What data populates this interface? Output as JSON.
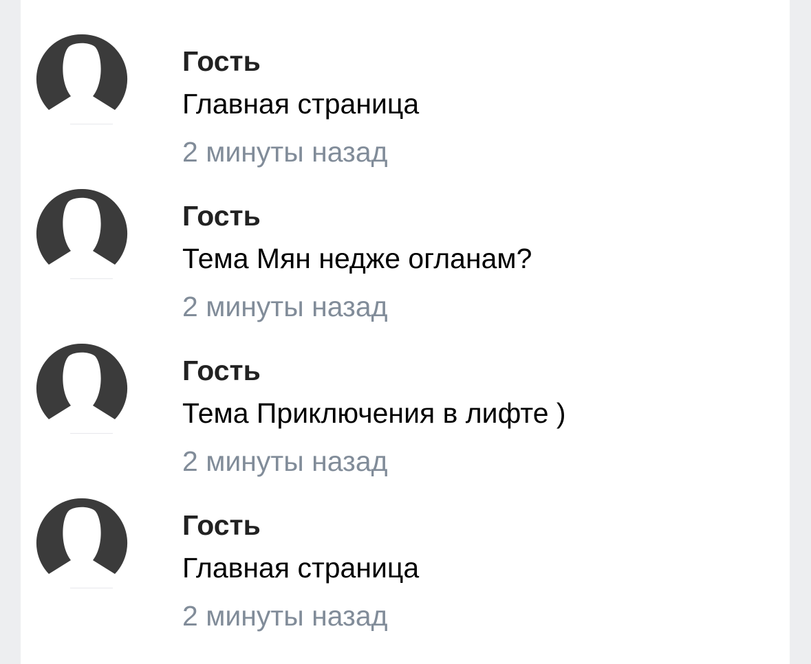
{
  "feed": {
    "items": [
      {
        "name": "Гость",
        "action": "Главная страница",
        "time": "2 минуты назад",
        "avatar_icon": "user-silhouette-icon"
      },
      {
        "name": "Гость",
        "action": "Тема Мян недже огланам?",
        "time": "2 минуты назад",
        "avatar_icon": "user-silhouette-icon"
      },
      {
        "name": "Гость",
        "action": "Тема Приключения в лифте )",
        "time": "2 минуты назад",
        "avatar_icon": "user-silhouette-icon"
      },
      {
        "name": "Гость",
        "action": "Главная страница",
        "time": "2 минуты назад",
        "avatar_icon": "user-silhouette-icon"
      }
    ]
  },
  "colors": {
    "page_background": "#edeef0",
    "card_background": "#ffffff",
    "avatar": "#3b3b3b",
    "name_text": "#222222",
    "action_text": "#000000",
    "time_text": "#818c99"
  }
}
